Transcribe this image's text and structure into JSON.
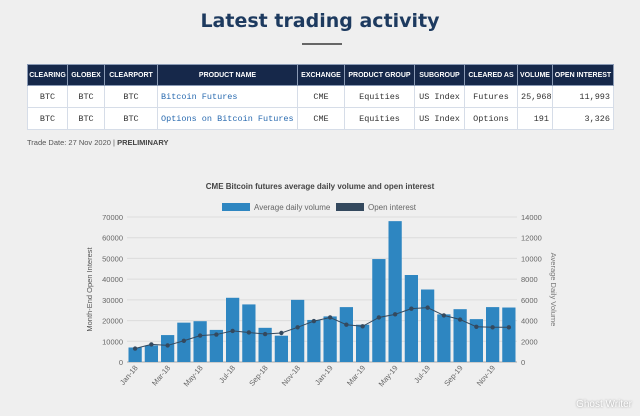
{
  "header": {
    "title": "Latest trading activity"
  },
  "table": {
    "columns": [
      "CLEARING",
      "GLOBEX",
      "CLEARPORT",
      "PRODUCT NAME",
      "EXCHANGE",
      "PRODUCT GROUP",
      "SUBGROUP",
      "CLEARED AS",
      "VOLUME",
      "OPEN INTEREST"
    ],
    "rows": [
      [
        "BTC",
        "BTC",
        "BTC",
        "Bitcoin Futures",
        "CME",
        "Equities",
        "US Index",
        "Futures",
        "25,968",
        "11,993"
      ],
      [
        "BTC",
        "BTC",
        "BTC",
        "Options on Bitcoin Futures",
        "CME",
        "Equities",
        "US Index",
        "Options",
        "191",
        "3,326"
      ]
    ]
  },
  "trade_date": {
    "label": "Trade Date: 27 Nov 2020 |",
    "status": "PRELIMINARY"
  },
  "watermark": "Ghost Writer",
  "chart_data": {
    "type": "bar",
    "title": "CME Bitcoin futures average daily volume and open interest",
    "categories": [
      "Jan-18",
      "Feb-18",
      "Mar-18",
      "Apr-18",
      "May-18",
      "Jun-18",
      "Jul-18",
      "Aug-18",
      "Sep-18",
      "Oct-18",
      "Nov-18",
      "Dec-18",
      "Jan-19",
      "Feb-19",
      "Mar-19",
      "Apr-19",
      "May-19",
      "Jun-19",
      "Jul-19",
      "Aug-19",
      "Sep-19",
      "Oct-19",
      "Nov-19",
      "Dec-19"
    ],
    "tick_labels": [
      "Jan-18",
      "Mar-18",
      "May-18",
      "Jul-18",
      "Sep-18",
      "Nov-18",
      "Jan-19",
      "Mar-19",
      "May-19",
      "Jul-19",
      "Sep-19",
      "Nov-19"
    ],
    "ylabel_left": "Month-End Open Interest",
    "ylabel_right": "Average Daily Volume",
    "ylim_left": [
      0,
      70000
    ],
    "ylim_right": [
      0,
      14000
    ],
    "yticks_left": [
      0,
      10000,
      20000,
      30000,
      40000,
      50000,
      60000,
      70000
    ],
    "yticks_right": [
      0,
      2000,
      4000,
      6000,
      8000,
      10000,
      12000,
      14000
    ],
    "grid": true,
    "legend_position": "top",
    "series": [
      {
        "name": "Average daily volume",
        "type": "bar",
        "axis": "left",
        "color": "#2e86c1",
        "values": [
          7000,
          8000,
          13000,
          19000,
          19700,
          15500,
          31000,
          27800,
          16500,
          12700,
          30000,
          20300,
          22000,
          26500,
          18000,
          49700,
          68000,
          42000,
          35000,
          23000,
          25500,
          20700,
          26500,
          26300
        ]
      },
      {
        "name": "Open interest",
        "type": "line",
        "axis": "right",
        "color": "#34495e",
        "values": [
          1300,
          1700,
          1600,
          2050,
          2550,
          2650,
          3000,
          2850,
          2700,
          2800,
          3350,
          3950,
          4300,
          3600,
          3450,
          4300,
          4600,
          5150,
          5250,
          4500,
          4100,
          3400,
          3350,
          3350
        ]
      }
    ]
  }
}
